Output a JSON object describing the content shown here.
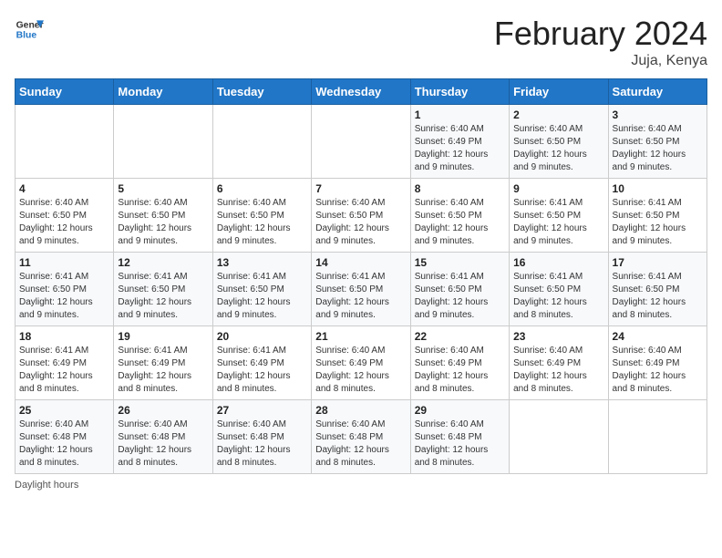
{
  "logo": {
    "line1": "General",
    "line2": "Blue"
  },
  "title": "February 2024",
  "subtitle": "Juja, Kenya",
  "days_of_week": [
    "Sunday",
    "Monday",
    "Tuesday",
    "Wednesday",
    "Thursday",
    "Friday",
    "Saturday"
  ],
  "footer": "Daylight hours",
  "weeks": [
    [
      {
        "day": "",
        "info": ""
      },
      {
        "day": "",
        "info": ""
      },
      {
        "day": "",
        "info": ""
      },
      {
        "day": "",
        "info": ""
      },
      {
        "day": "1",
        "info": "Sunrise: 6:40 AM\nSunset: 6:49 PM\nDaylight: 12 hours and 9 minutes."
      },
      {
        "day": "2",
        "info": "Sunrise: 6:40 AM\nSunset: 6:50 PM\nDaylight: 12 hours and 9 minutes."
      },
      {
        "day": "3",
        "info": "Sunrise: 6:40 AM\nSunset: 6:50 PM\nDaylight: 12 hours and 9 minutes."
      }
    ],
    [
      {
        "day": "4",
        "info": "Sunrise: 6:40 AM\nSunset: 6:50 PM\nDaylight: 12 hours and 9 minutes."
      },
      {
        "day": "5",
        "info": "Sunrise: 6:40 AM\nSunset: 6:50 PM\nDaylight: 12 hours and 9 minutes."
      },
      {
        "day": "6",
        "info": "Sunrise: 6:40 AM\nSunset: 6:50 PM\nDaylight: 12 hours and 9 minutes."
      },
      {
        "day": "7",
        "info": "Sunrise: 6:40 AM\nSunset: 6:50 PM\nDaylight: 12 hours and 9 minutes."
      },
      {
        "day": "8",
        "info": "Sunrise: 6:40 AM\nSunset: 6:50 PM\nDaylight: 12 hours and 9 minutes."
      },
      {
        "day": "9",
        "info": "Sunrise: 6:41 AM\nSunset: 6:50 PM\nDaylight: 12 hours and 9 minutes."
      },
      {
        "day": "10",
        "info": "Sunrise: 6:41 AM\nSunset: 6:50 PM\nDaylight: 12 hours and 9 minutes."
      }
    ],
    [
      {
        "day": "11",
        "info": "Sunrise: 6:41 AM\nSunset: 6:50 PM\nDaylight: 12 hours and 9 minutes."
      },
      {
        "day": "12",
        "info": "Sunrise: 6:41 AM\nSunset: 6:50 PM\nDaylight: 12 hours and 9 minutes."
      },
      {
        "day": "13",
        "info": "Sunrise: 6:41 AM\nSunset: 6:50 PM\nDaylight: 12 hours and 9 minutes."
      },
      {
        "day": "14",
        "info": "Sunrise: 6:41 AM\nSunset: 6:50 PM\nDaylight: 12 hours and 9 minutes."
      },
      {
        "day": "15",
        "info": "Sunrise: 6:41 AM\nSunset: 6:50 PM\nDaylight: 12 hours and 9 minutes."
      },
      {
        "day": "16",
        "info": "Sunrise: 6:41 AM\nSunset: 6:50 PM\nDaylight: 12 hours and 8 minutes."
      },
      {
        "day": "17",
        "info": "Sunrise: 6:41 AM\nSunset: 6:50 PM\nDaylight: 12 hours and 8 minutes."
      }
    ],
    [
      {
        "day": "18",
        "info": "Sunrise: 6:41 AM\nSunset: 6:49 PM\nDaylight: 12 hours and 8 minutes."
      },
      {
        "day": "19",
        "info": "Sunrise: 6:41 AM\nSunset: 6:49 PM\nDaylight: 12 hours and 8 minutes."
      },
      {
        "day": "20",
        "info": "Sunrise: 6:41 AM\nSunset: 6:49 PM\nDaylight: 12 hours and 8 minutes."
      },
      {
        "day": "21",
        "info": "Sunrise: 6:40 AM\nSunset: 6:49 PM\nDaylight: 12 hours and 8 minutes."
      },
      {
        "day": "22",
        "info": "Sunrise: 6:40 AM\nSunset: 6:49 PM\nDaylight: 12 hours and 8 minutes."
      },
      {
        "day": "23",
        "info": "Sunrise: 6:40 AM\nSunset: 6:49 PM\nDaylight: 12 hours and 8 minutes."
      },
      {
        "day": "24",
        "info": "Sunrise: 6:40 AM\nSunset: 6:49 PM\nDaylight: 12 hours and 8 minutes."
      }
    ],
    [
      {
        "day": "25",
        "info": "Sunrise: 6:40 AM\nSunset: 6:48 PM\nDaylight: 12 hours and 8 minutes."
      },
      {
        "day": "26",
        "info": "Sunrise: 6:40 AM\nSunset: 6:48 PM\nDaylight: 12 hours and 8 minutes."
      },
      {
        "day": "27",
        "info": "Sunrise: 6:40 AM\nSunset: 6:48 PM\nDaylight: 12 hours and 8 minutes."
      },
      {
        "day": "28",
        "info": "Sunrise: 6:40 AM\nSunset: 6:48 PM\nDaylight: 12 hours and 8 minutes."
      },
      {
        "day": "29",
        "info": "Sunrise: 6:40 AM\nSunset: 6:48 PM\nDaylight: 12 hours and 8 minutes."
      },
      {
        "day": "",
        "info": ""
      },
      {
        "day": "",
        "info": ""
      }
    ]
  ]
}
